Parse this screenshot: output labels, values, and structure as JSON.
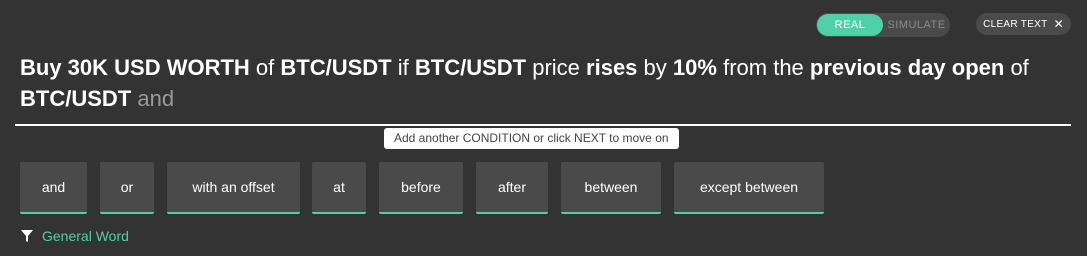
{
  "mode_toggle": {
    "real_label": "REAL",
    "simulate_label": "SIMULATE",
    "selected": "REAL"
  },
  "clear_text": {
    "label": "CLEAR TEXT",
    "icon": "close-icon"
  },
  "sentence": {
    "parts": [
      {
        "text": "Buy 30K USD WORTH",
        "style": "bold"
      },
      {
        "text": "of",
        "style": "normal"
      },
      {
        "text": "BTC/USDT",
        "style": "bold"
      },
      {
        "text": "if",
        "style": "normal"
      },
      {
        "text": "BTC/USDT",
        "style": "bold"
      },
      {
        "text": "price",
        "style": "normal"
      },
      {
        "text": "rises",
        "style": "bold"
      },
      {
        "text": "by",
        "style": "normal"
      },
      {
        "text": "10%",
        "style": "bold"
      },
      {
        "text": "from the",
        "style": "normal"
      },
      {
        "text": "previous day open",
        "style": "bold"
      },
      {
        "text": "of",
        "style": "normal"
      },
      {
        "text": "BTC/USDT",
        "style": "bold"
      },
      {
        "text": "and",
        "style": "faded"
      }
    ]
  },
  "hint": "Add another CONDITION or click NEXT to move on",
  "word_options": [
    "and",
    "or",
    "with an offset",
    "at",
    "before",
    "after",
    "between",
    "except between"
  ],
  "filter": {
    "label": "General Word",
    "icon": "filter-icon"
  },
  "colors": {
    "accent": "#4fd1a8",
    "background": "#333333",
    "button": "#4a4a4a"
  }
}
